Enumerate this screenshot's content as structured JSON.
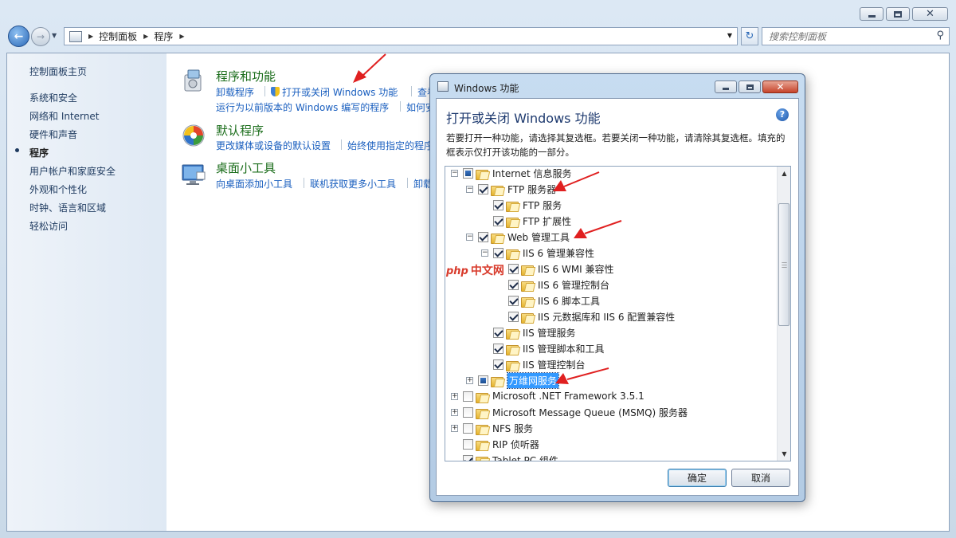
{
  "breadcrumb": [
    "控制面板",
    "程序"
  ],
  "search": {
    "placeholder": "搜索控制面板"
  },
  "left_nav": [
    "控制面板主页",
    "系统和安全",
    "网络和 Internet",
    "硬件和声音",
    "程序",
    "用户帐户和家庭安全",
    "外观和个性化",
    "时钟、语言和区域",
    "轻松访问"
  ],
  "left_nav_current": 4,
  "categories": [
    {
      "title": "程序和功能",
      "links": [
        "卸载程序",
        "打开或关闭 Windows 功能",
        "查看",
        "运行为以前版本的 Windows 编写的程序",
        "如何安"
      ]
    },
    {
      "title": "默认程序",
      "links": [
        "更改媒体或设备的默认设置",
        "始终使用指定的程序"
      ]
    },
    {
      "title": "桌面小工具",
      "links": [
        "向桌面添加小工具",
        "联机获取更多小工具",
        "卸载"
      ]
    }
  ],
  "dialog": {
    "title": "Windows 功能",
    "heading": "打开或关闭 Windows 功能",
    "description": "若要打开一种功能，请选择其复选框。若要关闭一种功能，请清除其复选框。填充的框表示仅打开该功能的一部分。",
    "ok": "确定",
    "cancel": "取消"
  },
  "tree": [
    {
      "label": "Internet 信息服务",
      "level": 0,
      "state": "partial",
      "expander": "minus"
    },
    {
      "label": "FTP 服务器",
      "level": 1,
      "state": "checked",
      "expander": "minus"
    },
    {
      "label": "FTP 服务",
      "level": 2,
      "state": "checked",
      "expander": "none"
    },
    {
      "label": "FTP 扩展性",
      "level": 2,
      "state": "checked",
      "expander": "none"
    },
    {
      "label": "Web 管理工具",
      "level": 1,
      "state": "checked",
      "expander": "minus"
    },
    {
      "label": "IIS 6 管理兼容性",
      "level": 2,
      "state": "checked",
      "expander": "minus"
    },
    {
      "label": "IIS 6 WMI 兼容性",
      "level": 3,
      "state": "checked",
      "expander": "none"
    },
    {
      "label": "IIS 6 管理控制台",
      "level": 3,
      "state": "checked",
      "expander": "none"
    },
    {
      "label": "IIS 6 脚本工具",
      "level": 3,
      "state": "checked",
      "expander": "none"
    },
    {
      "label": "IIS 元数据库和 IIS 6 配置兼容性",
      "level": 3,
      "state": "checked",
      "expander": "none"
    },
    {
      "label": "IIS 管理服务",
      "level": 2,
      "state": "checked",
      "expander": "none"
    },
    {
      "label": "IIS 管理脚本和工具",
      "level": 2,
      "state": "checked",
      "expander": "none"
    },
    {
      "label": "IIS 管理控制台",
      "level": 2,
      "state": "checked",
      "expander": "none"
    },
    {
      "label": "万维网服务",
      "level": 1,
      "state": "partial",
      "expander": "plus",
      "selected": true
    },
    {
      "label": "Microsoft .NET Framework 3.5.1",
      "level": 0,
      "state": "unchecked",
      "expander": "plus"
    },
    {
      "label": "Microsoft Message Queue (MSMQ) 服务器",
      "level": 0,
      "state": "unchecked",
      "expander": "plus"
    },
    {
      "label": "NFS 服务",
      "level": 0,
      "state": "unchecked",
      "expander": "plus"
    },
    {
      "label": "RIP 侦听器",
      "level": 0,
      "state": "unchecked",
      "expander": "none"
    },
    {
      "label": "Tablet PC 组件",
      "level": 0,
      "state": "checked",
      "expander": "none"
    }
  ],
  "watermark": {
    "brand": "php",
    "text": "中文网"
  },
  "colors": {
    "annotation_arrow": "#e02020",
    "link": "#1a5fbf",
    "category_title": "#1b6d1b"
  }
}
